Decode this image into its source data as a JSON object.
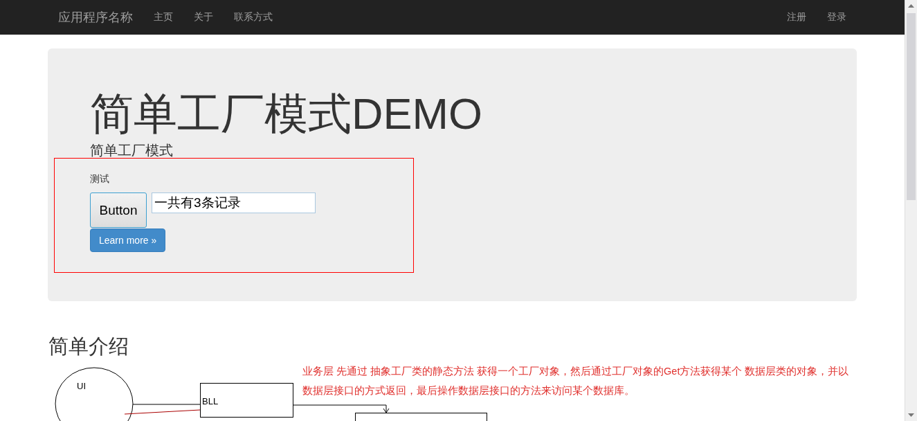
{
  "navbar": {
    "brand": "应用程序名称",
    "links": [
      {
        "label": "主页"
      },
      {
        "label": "关于"
      },
      {
        "label": "联系方式"
      }
    ],
    "right_links": [
      {
        "label": "注册"
      },
      {
        "label": "登录"
      }
    ]
  },
  "jumbotron": {
    "title": "简单工厂模式DEMO",
    "subtitle": "简单工厂模式",
    "panel": {
      "label": "测试",
      "button": "Button",
      "field_value": "一共有3条记录",
      "learn_more": "Learn more »"
    }
  },
  "intro": {
    "heading": "简单介绍",
    "diagram": {
      "ui_label": "UI",
      "bll_label": "BLL"
    },
    "note": "业务层 先通过 抽象工厂类的静态方法 获得一个工厂对象，然后通过工厂对象的Get方法获得某个 数据层类的对象，并以数据层接口的方式返回，最后操作数据层接口的方法来访问某个数据库。"
  }
}
